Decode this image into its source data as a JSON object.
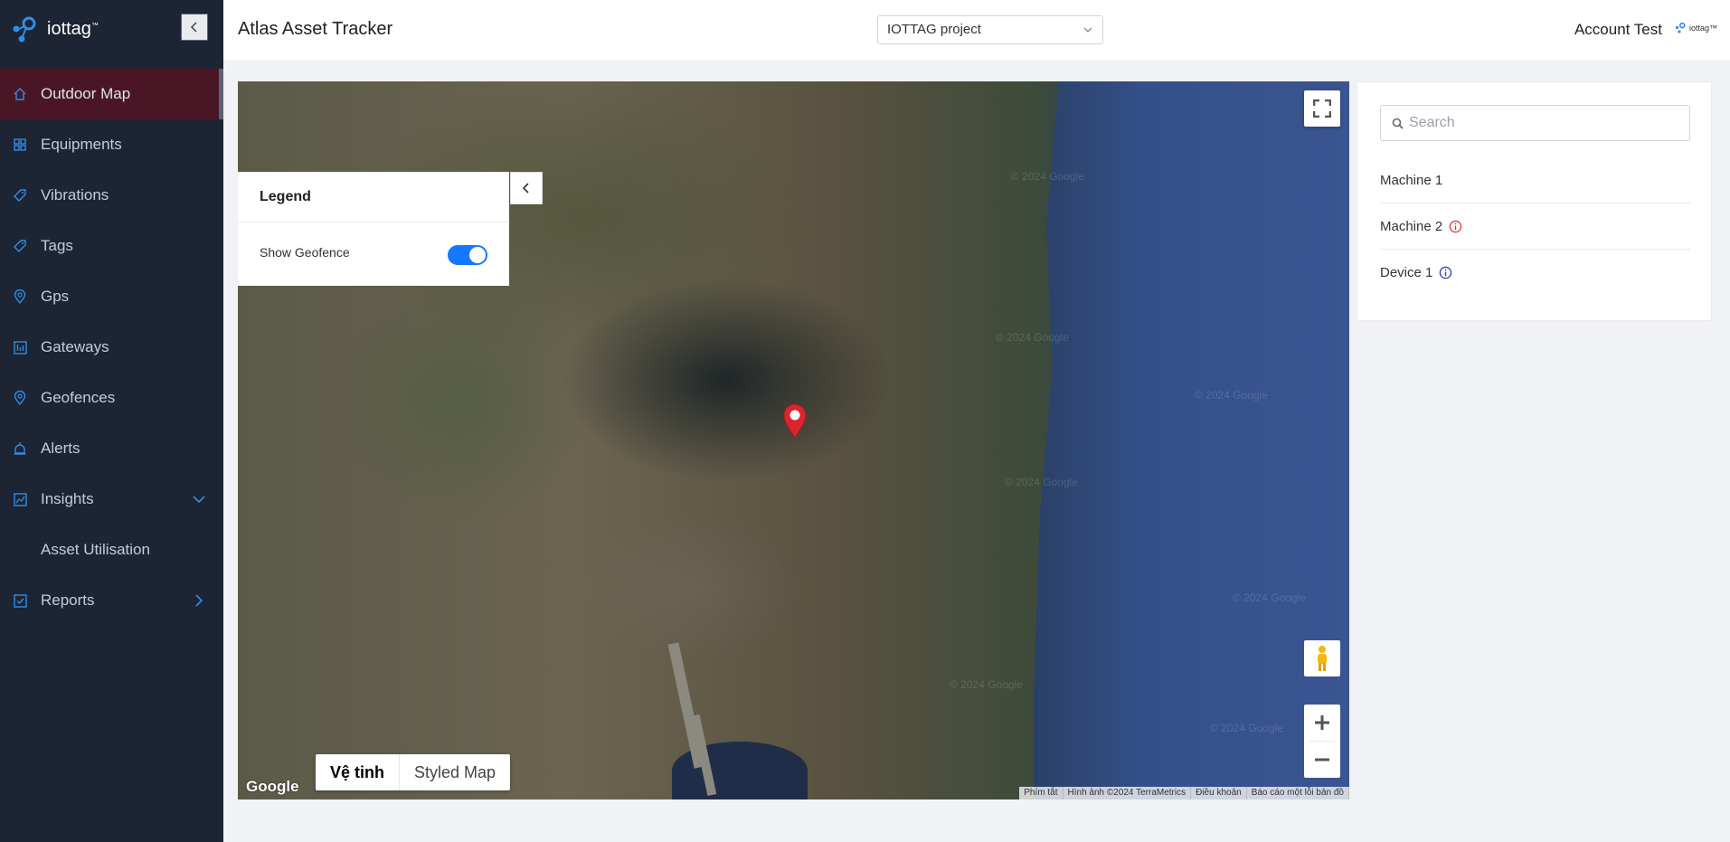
{
  "app": {
    "brand_name": "iottag",
    "brand_tm": "™"
  },
  "sidebar": {
    "items": [
      {
        "label": "Outdoor Map",
        "icon": "home-icon",
        "active": true
      },
      {
        "label": "Equipments",
        "icon": "grid-icon"
      },
      {
        "label": "Vibrations",
        "icon": "tag-icon"
      },
      {
        "label": "Tags",
        "icon": "tag-icon"
      },
      {
        "label": "Gps",
        "icon": "location-pin-icon"
      },
      {
        "label": "Gateways",
        "icon": "gateway-icon"
      },
      {
        "label": "Geofences",
        "icon": "location-pin-icon"
      },
      {
        "label": "Alerts",
        "icon": "alarm-icon"
      },
      {
        "label": "Insights",
        "icon": "chart-icon",
        "expanded": true
      },
      {
        "label": "Asset Utilisation",
        "sub": true
      },
      {
        "label": "Reports",
        "icon": "checklist-icon",
        "expanded": false
      }
    ]
  },
  "header": {
    "title": "Atlas Asset Tracker",
    "project": "IOTTAG project",
    "account": "Account Test",
    "logo_text": "iottag™"
  },
  "map": {
    "legend_title": "Legend",
    "show_geofence_label": "Show Geofence",
    "show_geofence_on": true,
    "maptype": {
      "satellite": "Vệ tinh",
      "styled": "Styled Map"
    },
    "google_logo": "Google",
    "watermark": "© 2024 Google",
    "attribution": [
      "Phím tắt",
      "Hình ảnh ©2024 TerraMetrics",
      "Điều khoản",
      "Báo cáo một lỗi bản đồ"
    ]
  },
  "panel": {
    "search_placeholder": "Search",
    "devices": [
      {
        "name": "Machine 1",
        "status": "none"
      },
      {
        "name": "Machine 2",
        "status": "alert",
        "color": "#e53935"
      },
      {
        "name": "Device 1",
        "status": "info",
        "color": "#2f3fb8"
      }
    ]
  },
  "colors": {
    "sidebar_bg": "#1d2433",
    "active_item_bg": "#4a1626",
    "accent_blue": "#1677ff",
    "marker_red": "#d9262c"
  }
}
